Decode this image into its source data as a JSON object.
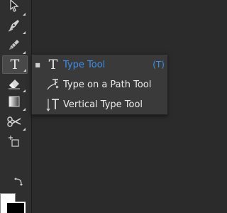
{
  "toolbar": {
    "tools": [
      {
        "name": "direct-selection",
        "icon": "arrow-white-icon"
      },
      {
        "name": "pen",
        "icon": "pen-icon"
      },
      {
        "name": "pencil",
        "icon": "pencil-icon"
      },
      {
        "name": "type",
        "icon": "type-icon",
        "glyph": "T"
      },
      {
        "name": "eraser",
        "icon": "eraser-icon"
      },
      {
        "name": "gradient",
        "icon": "gradient-icon"
      },
      {
        "name": "scissors",
        "icon": "scissors-icon"
      },
      {
        "name": "free-transform",
        "icon": "transform-icon"
      },
      {
        "name": "swap-colors",
        "icon": "swap-arrow-icon"
      },
      {
        "name": "fill-stroke",
        "icon": "fill-stroke-icon"
      }
    ]
  },
  "flyout": {
    "items": [
      {
        "label": "Type Tool",
        "shortcut": "(T)",
        "icon_glyph": "T",
        "selected": true,
        "bullet": "■"
      },
      {
        "label": "Type on a Path Tool",
        "shortcut": "",
        "icon_glyph": "T",
        "selected": false
      },
      {
        "label": "Vertical Type Tool",
        "shortcut": "",
        "icon_glyph": "T",
        "selected": false
      }
    ]
  },
  "colors": {
    "accent": "#3d8ee8",
    "panel": "#3a3a3a",
    "toolbar": "#2f2f2f"
  }
}
